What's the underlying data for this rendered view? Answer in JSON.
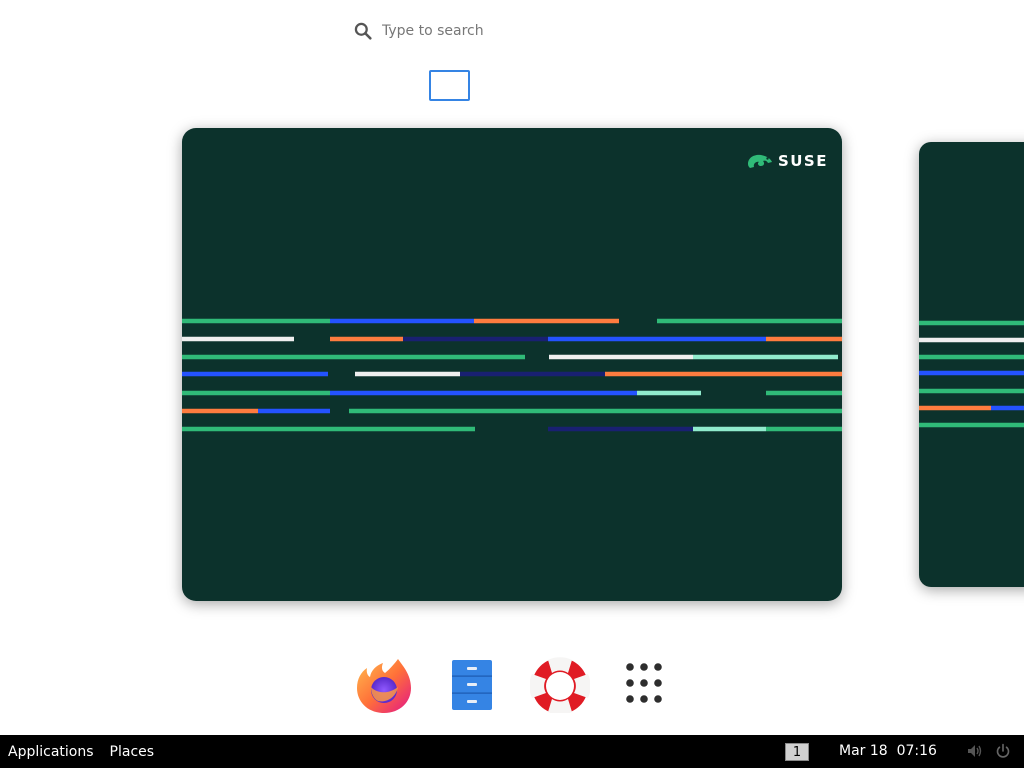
{
  "search": {
    "placeholder": "Type to search",
    "icon": "search-icon"
  },
  "workspaces": {
    "thumbnails": [
      {
        "active": true
      }
    ],
    "main_preview": {
      "logo_text": "SUSE"
    },
    "accent_color": "#3584e4"
  },
  "wallpaper": {
    "background": "#0c322c",
    "colors": {
      "green": "#30ba78",
      "blue": "#2453ff",
      "orange": "#fe7c3f",
      "white": "#efefef",
      "mint": "#90ebcd",
      "navy": "#192072"
    }
  },
  "dash": {
    "items": [
      {
        "name": "Firefox",
        "icon": "firefox-icon"
      },
      {
        "name": "Files",
        "icon": "file-cabinet-icon"
      },
      {
        "name": "Help",
        "icon": "lifebuoy-icon"
      },
      {
        "name": "Show Applications",
        "icon": "app-grid-icon"
      }
    ]
  },
  "panel": {
    "applications_label": "Applications",
    "places_label": "Places",
    "workspace_number": "1",
    "clock": "Mar 18  07:16",
    "volume_icon": "volume-icon",
    "power_icon": "power-icon"
  }
}
